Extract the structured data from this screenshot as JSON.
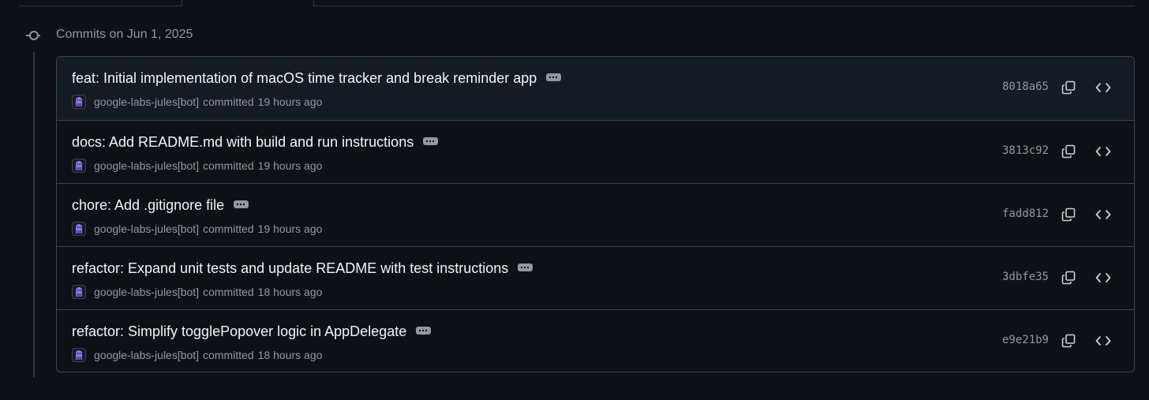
{
  "group": {
    "title": "Commits on Jun 1, 2025"
  },
  "icons": {
    "timeline": "git-commit-icon",
    "copy": "copy-icon",
    "browse": "code-icon",
    "expand": "ellipsis-icon",
    "avatar": "jules-bot-avatar"
  },
  "colors": {
    "background": "#0d1117",
    "border": "#3d444d",
    "muted": "#9198a1",
    "avatar_accent": "#8e75ff"
  },
  "commits": [
    {
      "message": "feat: Initial implementation of macOS time tracker and break reminder app",
      "author": "google-labs-jules[bot]",
      "verb": "committed",
      "time": "19 hours ago",
      "sha": "8018a65"
    },
    {
      "message": "docs: Add README.md with build and run instructions",
      "author": "google-labs-jules[bot]",
      "verb": "committed",
      "time": "19 hours ago",
      "sha": "3813c92"
    },
    {
      "message": "chore: Add .gitignore file",
      "author": "google-labs-jules[bot]",
      "verb": "committed",
      "time": "19 hours ago",
      "sha": "fadd812"
    },
    {
      "message": "refactor: Expand unit tests and update README with test instructions",
      "author": "google-labs-jules[bot]",
      "verb": "committed",
      "time": "18 hours ago",
      "sha": "3dbfe35"
    },
    {
      "message": "refactor: Simplify togglePopover logic in AppDelegate",
      "author": "google-labs-jules[bot]",
      "verb": "committed",
      "time": "18 hours ago",
      "sha": "e9e21b9"
    }
  ]
}
